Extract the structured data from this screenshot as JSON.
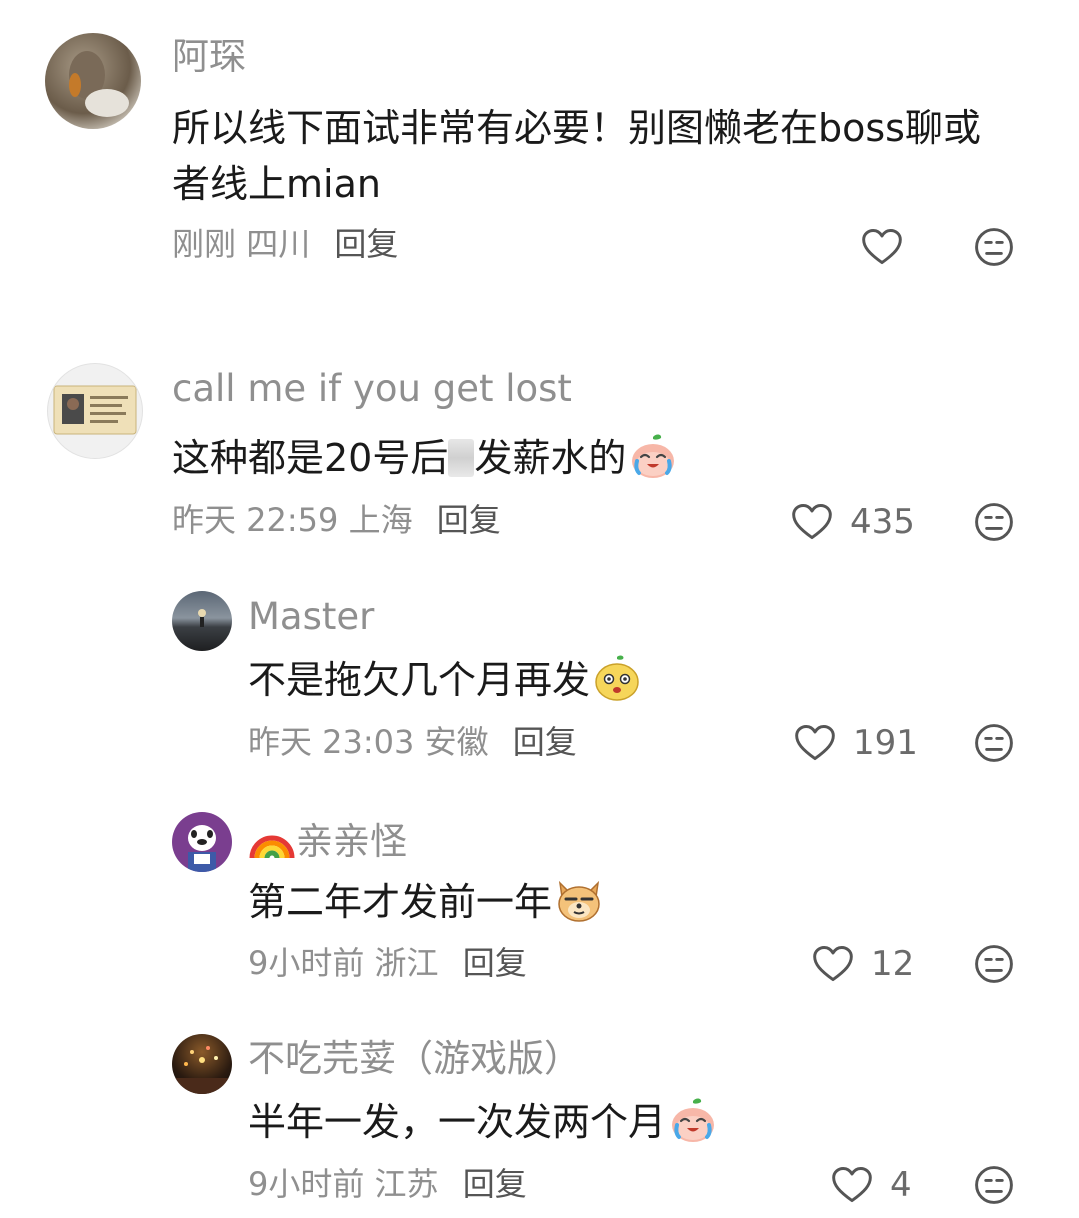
{
  "comments": [
    {
      "name": "阿琛",
      "text": "所以线下面试非常有必要！别图懒老在boss聊或者线上mian",
      "time": "刚刚",
      "location": "四川",
      "reply": "回复",
      "likes": ""
    },
    {
      "name": "call me if you get lost",
      "text_before": "这种都是20号后",
      "text_after": "发薪水的",
      "time": "昨天 22:59",
      "location": "上海",
      "reply": "回复",
      "likes": "435"
    },
    {
      "name": "Master",
      "text": "不是拖欠几个月再发",
      "time": "昨天 23:03",
      "location": "安徽",
      "reply": "回复",
      "likes": "191"
    },
    {
      "name": "亲亲怪",
      "text": "第二年才发前一年",
      "time": "9小时前",
      "location": "浙江",
      "reply": "回复",
      "likes": "12"
    },
    {
      "name": "不吃芫荽（游戏版）",
      "text": "半年一发，一次发两个月",
      "time": "9小时前",
      "location": "江苏",
      "reply": "回复",
      "likes": "4"
    }
  ],
  "icons": {
    "like": "heart-outline-icon",
    "dislike": "neutral-face-icon",
    "badge": "rainbow-emoji"
  },
  "colors": {
    "meta": "#8f8f8f",
    "text": "#1a1a1a",
    "icon": "#555555"
  }
}
